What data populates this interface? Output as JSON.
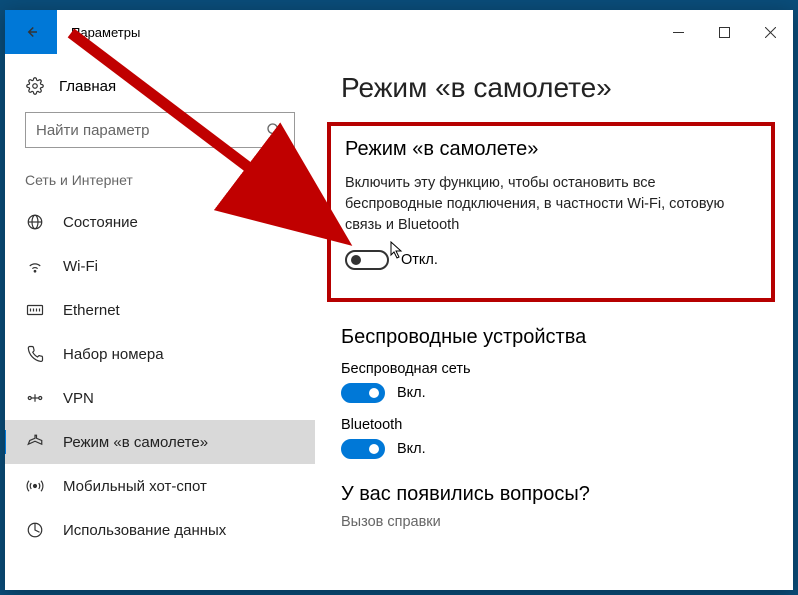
{
  "window": {
    "title": "Параметры"
  },
  "sidebar": {
    "home": "Главная",
    "search_placeholder": "Найти параметр",
    "section": "Сеть и Интернет",
    "items": [
      {
        "label": "Состояние"
      },
      {
        "label": "Wi-Fi"
      },
      {
        "label": "Ethernet"
      },
      {
        "label": "Набор номера"
      },
      {
        "label": "VPN"
      },
      {
        "label": "Режим «в самолете»"
      },
      {
        "label": "Мобильный хот-спот"
      },
      {
        "label": "Использование данных"
      }
    ]
  },
  "content": {
    "heading": "Режим «в самолете»",
    "airplane": {
      "title": "Режим «в самолете»",
      "description": "Включить эту функцию, чтобы остановить все беспроводные подключения, в частности Wi-Fi, сотовую связь и Bluetooth",
      "state": "Откл."
    },
    "wireless": {
      "title": "Беспроводные устройства",
      "wifi_label": "Беспроводная сеть",
      "wifi_state": "Вкл.",
      "bt_label": "Bluetooth",
      "bt_state": "Вкл."
    },
    "help": {
      "title": "У вас появились вопросы?",
      "link": "Вызов справки"
    }
  }
}
